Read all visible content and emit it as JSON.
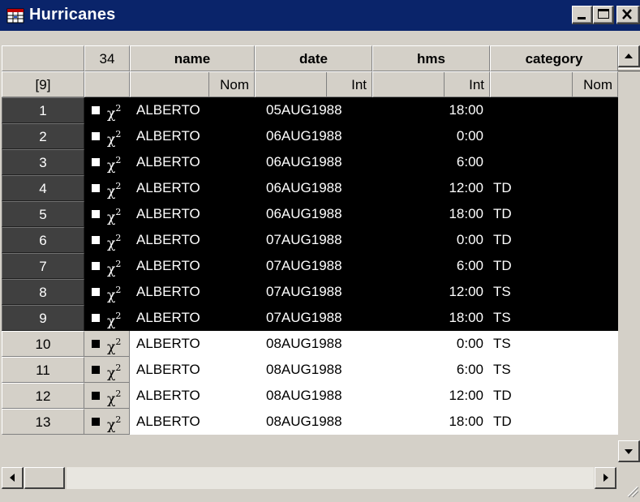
{
  "window": {
    "title": "Hurricanes",
    "icons": [
      "table-icon",
      "minimize-icon",
      "maximize-icon",
      "close-icon"
    ]
  },
  "header": {
    "count": "34",
    "selected_count": "[9]",
    "columns": [
      {
        "name": "name",
        "measure": "Nom"
      },
      {
        "name": "date",
        "measure": "Int"
      },
      {
        "name": "hms",
        "measure": "Int"
      },
      {
        "name": "category",
        "measure": "Nom"
      }
    ]
  },
  "row_symbol": {
    "marker": "square-marker-icon",
    "chi": "χ",
    "sup": "2"
  },
  "rows": [
    {
      "n": "1",
      "name": "ALBERTO",
      "date": "05AUG1988",
      "hms": "18:00",
      "category": "",
      "selected": true
    },
    {
      "n": "2",
      "name": "ALBERTO",
      "date": "06AUG1988",
      "hms": "0:00",
      "category": "",
      "selected": true
    },
    {
      "n": "3",
      "name": "ALBERTO",
      "date": "06AUG1988",
      "hms": "6:00",
      "category": "",
      "selected": true
    },
    {
      "n": "4",
      "name": "ALBERTO",
      "date": "06AUG1988",
      "hms": "12:00",
      "category": "TD",
      "selected": true
    },
    {
      "n": "5",
      "name": "ALBERTO",
      "date": "06AUG1988",
      "hms": "18:00",
      "category": "TD",
      "selected": true
    },
    {
      "n": "6",
      "name": "ALBERTO",
      "date": "07AUG1988",
      "hms": "0:00",
      "category": "TD",
      "selected": true
    },
    {
      "n": "7",
      "name": "ALBERTO",
      "date": "07AUG1988",
      "hms": "6:00",
      "category": "TD",
      "selected": true
    },
    {
      "n": "8",
      "name": "ALBERTO",
      "date": "07AUG1988",
      "hms": "12:00",
      "category": "TS",
      "selected": true
    },
    {
      "n": "9",
      "name": "ALBERTO",
      "date": "07AUG1988",
      "hms": "18:00",
      "category": "TS",
      "selected": true
    },
    {
      "n": "10",
      "name": "ALBERTO",
      "date": "08AUG1988",
      "hms": "0:00",
      "category": "TS",
      "selected": false
    },
    {
      "n": "11",
      "name": "ALBERTO",
      "date": "08AUG1988",
      "hms": "6:00",
      "category": "TS",
      "selected": false
    },
    {
      "n": "12",
      "name": "ALBERTO",
      "date": "08AUG1988",
      "hms": "12:00",
      "category": "TD",
      "selected": false
    },
    {
      "n": "13",
      "name": "ALBERTO",
      "date": "08AUG1988",
      "hms": "18:00",
      "category": "TD",
      "selected": false
    }
  ],
  "scrollbars": {
    "icons": [
      "scroll-up-icon",
      "scroll-down-icon",
      "scroll-left-icon",
      "scroll-right-icon",
      "resize-grip-icon"
    ]
  }
}
